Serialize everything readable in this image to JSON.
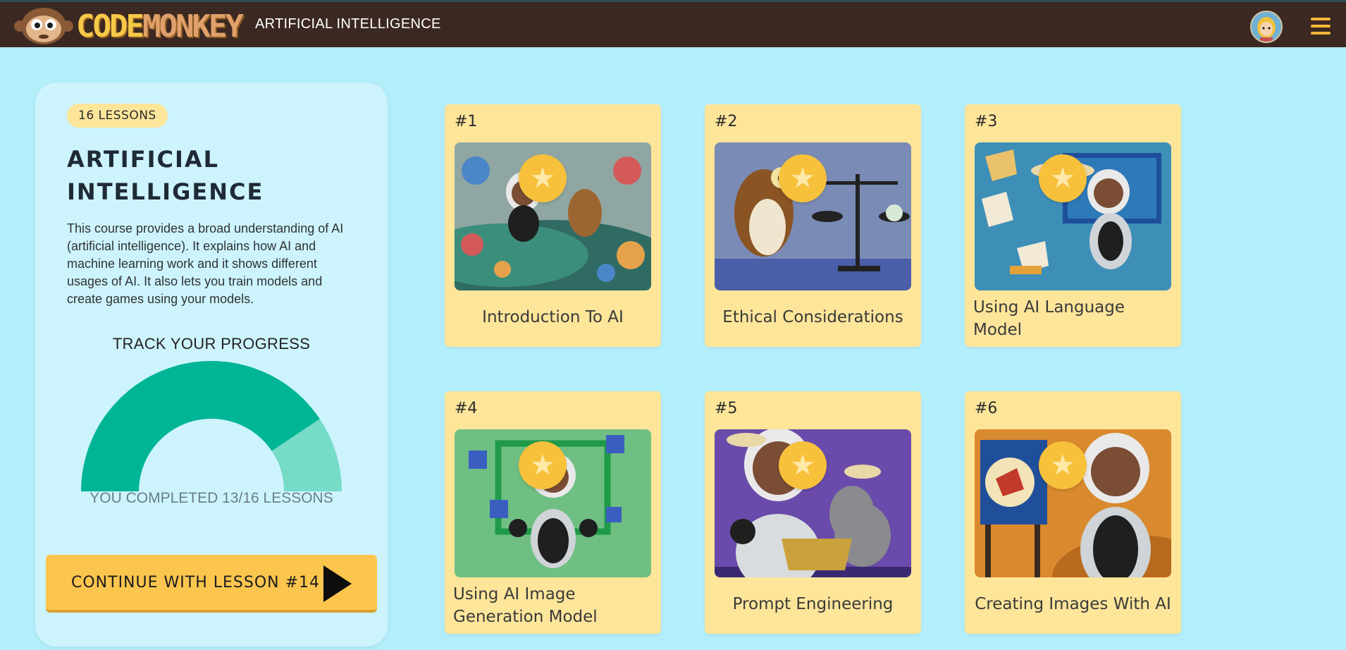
{
  "header": {
    "logo_text_code": "CODE",
    "logo_text_monkey": "MONKEY",
    "title": "ARTIFICIAL INTELLIGENCE"
  },
  "course": {
    "badge": "16 LESSONS",
    "title": "ARTIFICIAL INTELLIGENCE",
    "description": "This course provides a broad understanding of AI (artificial intelligence). It explains how AI and machine learning work and it shows different usages of AI. It also lets you train models and create games using your models.",
    "track_title": "TRACK YOUR PROGRESS",
    "completed_text": "YOU COMPLETED 13/16 LESSONS",
    "completed": 13,
    "total": 16,
    "continue_label": "CONTINUE WITH LESSON #14"
  },
  "colors": {
    "gauge_done": "#00b596",
    "gauge_remaining": "#76dcc8",
    "accent": "#fcc54e",
    "header_bg": "#3b2822"
  },
  "lessons": [
    {
      "number": "#1",
      "title": "Introduction To AI",
      "icon": "star-icon"
    },
    {
      "number": "#2",
      "title": "Ethical Considerations",
      "icon": "star-icon"
    },
    {
      "number": "#3",
      "title": "Using AI Language Model",
      "icon": "star-icon"
    },
    {
      "number": "#4",
      "title": "Using AI Image Generation Model",
      "icon": "star-icon"
    },
    {
      "number": "#5",
      "title": "Prompt Engineering",
      "icon": "star-icon"
    },
    {
      "number": "#6",
      "title": "Creating Images With AI",
      "icon": "star-icon"
    }
  ]
}
